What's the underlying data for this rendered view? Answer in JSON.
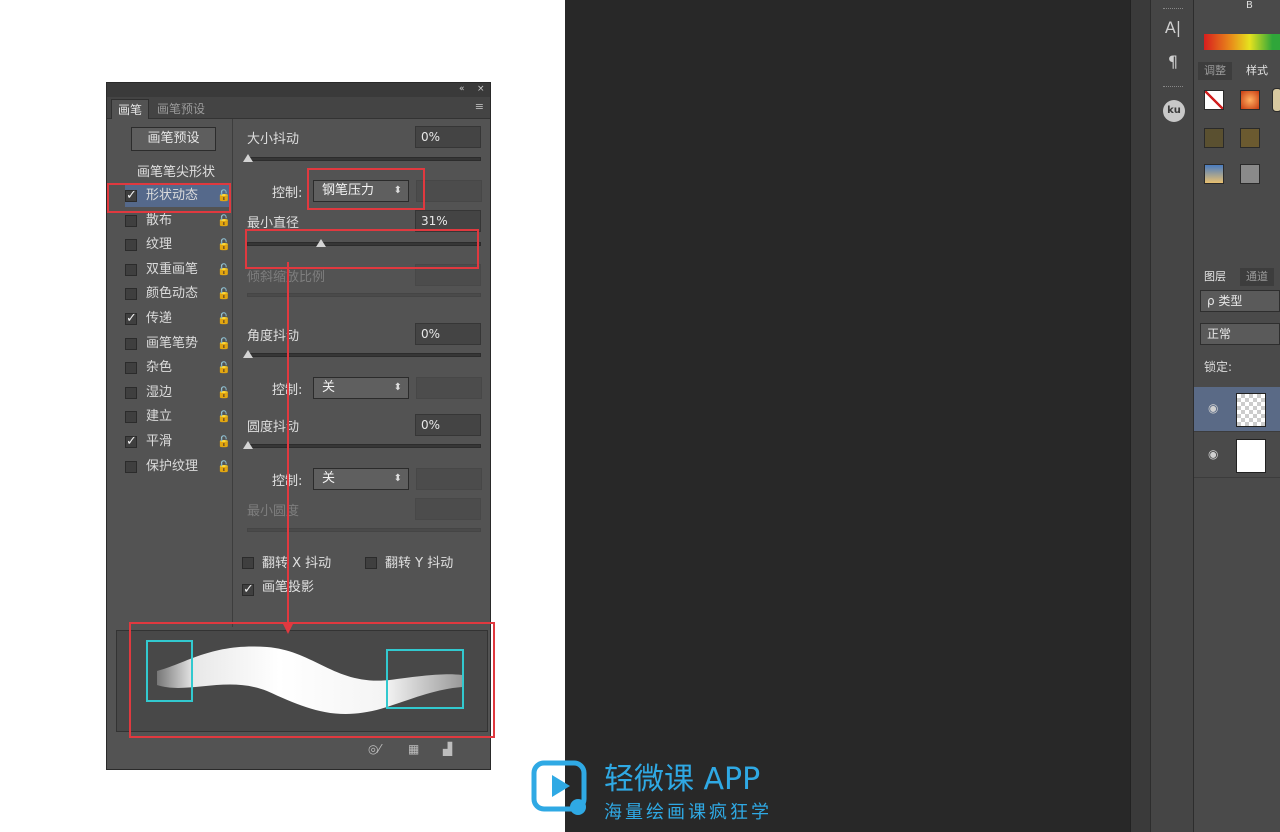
{
  "panel": {
    "collapse_btn": "«",
    "close_btn": "×",
    "tabs": [
      "画笔",
      "画笔预设"
    ],
    "menu_icon": "≡",
    "preset_button": "画笔预设",
    "tip_shape_header": "画笔笔尖形状",
    "options": [
      {
        "label": "形状动态",
        "checked": true,
        "selected": true
      },
      {
        "label": "散布",
        "checked": false
      },
      {
        "label": "纹理",
        "checked": false
      },
      {
        "label": "双重画笔",
        "checked": false
      },
      {
        "label": "颜色动态",
        "checked": false
      },
      {
        "label": "传递",
        "checked": true
      },
      {
        "label": "画笔笔势",
        "checked": false
      },
      {
        "label": "杂色",
        "checked": false
      },
      {
        "label": "湿边",
        "checked": false
      },
      {
        "label": "建立",
        "checked": false
      },
      {
        "label": "平滑",
        "checked": true
      },
      {
        "label": "保护纹理",
        "checked": false
      }
    ],
    "lock_icon": "🔓",
    "check_mark": "✓",
    "size_jitter": {
      "label": "大小抖动",
      "value": "0%"
    },
    "control_label": "控制:",
    "size_control": "钢笔压力",
    "min_diameter": {
      "label": "最小直径",
      "value": "31%",
      "fraction": 0.31
    },
    "tilt_scale": {
      "label": "倾斜缩放比例"
    },
    "angle_jitter": {
      "label": "角度抖动",
      "value": "0%"
    },
    "angle_control": "关",
    "roundness_jitter": {
      "label": "圆度抖动",
      "value": "0%"
    },
    "roundness_control": "关",
    "min_roundness": {
      "label": "最小圆度"
    },
    "flip_x": {
      "label": "翻转 X 抖动",
      "checked": false
    },
    "flip_y": {
      "label": "翻转 Y 抖动",
      "checked": false
    },
    "brush_projection": {
      "label": "画笔投影",
      "checked": true
    },
    "select_arrow": "⬍",
    "bottom_icons": [
      "◎⁄",
      "▦",
      "▟"
    ]
  },
  "right": {
    "channel": "B",
    "tool_icons": [
      "A|",
      "¶"
    ],
    "ku": "ku",
    "tabs_top": [
      "调整",
      "样式"
    ],
    "tabs_layers": [
      "图层",
      "通道"
    ],
    "kind_field": "ρ 类型",
    "blend_mode": "正常",
    "lock_label": "锁定:",
    "eye_icon": "◉"
  },
  "watermark": {
    "title": "轻微课 APP",
    "subtitle": "海量绘画课疯狂学"
  },
  "colors": {
    "annotation_red": "#e0393f",
    "annotation_cyan": "#32c9cf",
    "brand_blue": "#2fa9e4"
  }
}
